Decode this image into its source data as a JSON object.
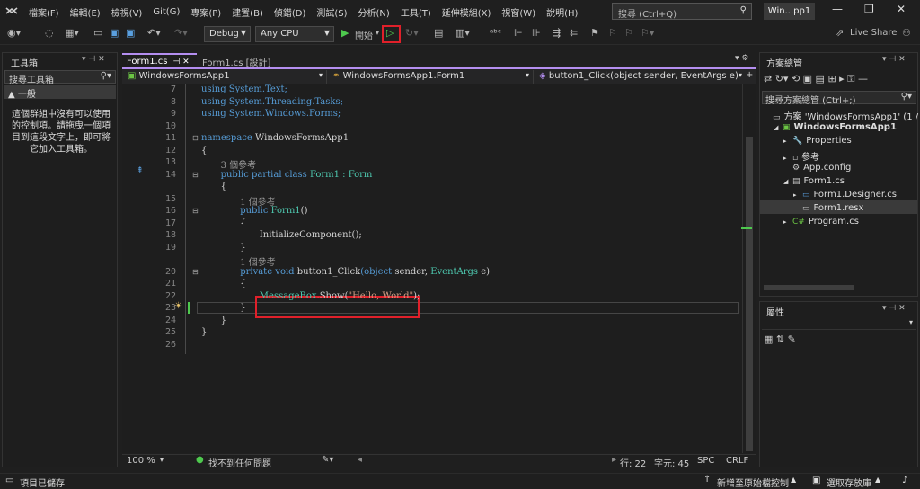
{
  "menu": [
    "檔案(F)",
    "編輯(E)",
    "檢視(V)",
    "Git(G)",
    "專案(P)",
    "建置(B)",
    "偵錯(D)",
    "測試(S)",
    "分析(N)",
    "工具(T)",
    "延伸模組(X)",
    "視窗(W)",
    "說明(H)"
  ],
  "search": {
    "placeholder": "搜尋 (Ctrl+Q)"
  },
  "window_title": "Win...pp1",
  "toolbar": {
    "config": "Debug",
    "platform": "Any CPU",
    "start_label": "開始",
    "live_share": "Live Share"
  },
  "toolbox": {
    "title": "工具箱",
    "search": "搜尋工具箱",
    "group": "▲ 一般",
    "empty_msg": "這個群組中沒有可以使用的控制項。請拖曳一個項目到這段文字上，即可將它加入工具箱。"
  },
  "tabs": [
    {
      "label": "Form1.cs"
    },
    {
      "label": "Form1.cs [設計]"
    }
  ],
  "navbar": {
    "project": "WindowsFormsApp1",
    "class": "WindowsFormsApp1.Form1",
    "member": "button1_Click(object sender, EventArgs e)"
  },
  "code": {
    "line_numbers": [
      "7",
      "8",
      "9",
      "10",
      "11",
      "12",
      "13",
      "14",
      "",
      "15",
      "16",
      "17",
      "18",
      "19",
      "",
      "20",
      "21",
      "22",
      "23",
      "24",
      "25",
      "26"
    ],
    "l7": "using System.Text;",
    "l8": "using System.Threading.Tasks;",
    "l9": "using System.Windows.Forms;",
    "l11_kw": "namespace",
    "l11_name": "WindowsFormsApp1",
    "brace_open": "{",
    "brace_close": "}",
    "refs3": "3 個參考",
    "l13_kw": "public partial class",
    "l13_name": "Form1",
    "l13_base": ": Form",
    "refs1": "1 個參考",
    "l15_kw": "public",
    "l15_name": "Form1",
    "l15_paren": "()",
    "l17": "InitializeComponent();",
    "l20_kw": "private void",
    "l20_name": "button1_Click",
    "l20_p1": "(object",
    "l20_p2": "sender,",
    "l20_ty": "EventArgs",
    "l20_end": "e)",
    "l22_ty": "MessageBox",
    "l22_m": ".Show(",
    "l22_str": "\"Hello, World\"",
    "l22_end": ");"
  },
  "status": {
    "zoom": "100 %",
    "issues": "找不到任何問題",
    "line": "行: 22",
    "col": "字元: 45",
    "spc": "SPC",
    "crlf": "CRLF"
  },
  "solution": {
    "title": "方案總管",
    "search": "搜尋方案總管 (Ctrl+;)",
    "items": [
      "方案 'WindowsFormsApp1' (1 / 1 個專案)",
      "WindowsFormsApp1",
      "Properties",
      "參考",
      "App.config",
      "Form1.cs",
      "Form1.Designer.cs",
      "Form1.resx",
      "Program.cs"
    ]
  },
  "properties": {
    "title": "屬性"
  },
  "bottom": {
    "saved": "項目已儲存",
    "source_control": "新增至原始檔控制",
    "repo": "選取存放庫"
  },
  "colors": {
    "accent": "#e0202a",
    "tab_active": "#b48ef0",
    "play": "#4ec94e"
  }
}
